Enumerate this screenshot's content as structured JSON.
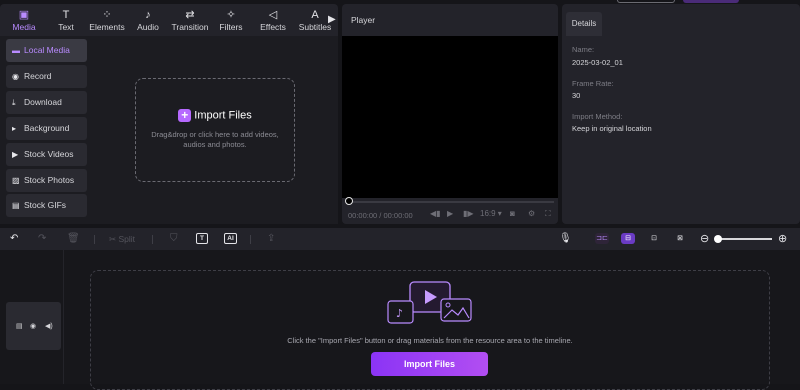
{
  "top_tabs": [
    {
      "label": "Media",
      "icon": "media-icon",
      "glyph": "▣"
    },
    {
      "label": "Text",
      "icon": "text-icon",
      "glyph": "T"
    },
    {
      "label": "Elements",
      "icon": "elements-icon",
      "glyph": "⁘"
    },
    {
      "label": "Audio",
      "icon": "audio-icon",
      "glyph": "♪"
    },
    {
      "label": "Transition",
      "icon": "transition-icon",
      "glyph": "⇄"
    },
    {
      "label": "Filters",
      "icon": "filters-icon",
      "glyph": "✧"
    },
    {
      "label": "Effects",
      "icon": "effects-icon",
      "glyph": "◁"
    },
    {
      "label": "Subtitles",
      "icon": "subtitles-icon",
      "glyph": "A"
    }
  ],
  "active_tab": "Media",
  "sidebar": {
    "items": [
      {
        "label": "Local Media",
        "icon": "folder-icon",
        "glyph": "▬"
      },
      {
        "label": "Record",
        "icon": "record-icon",
        "glyph": "◉"
      },
      {
        "label": "Download",
        "icon": "download-icon",
        "glyph": "⤓"
      },
      {
        "label": "Background",
        "icon": "background-icon",
        "glyph": "▸"
      },
      {
        "label": "Stock Videos",
        "icon": "stock-videos-icon",
        "glyph": "▶"
      },
      {
        "label": "Stock Photos",
        "icon": "stock-photos-icon",
        "glyph": "▨"
      },
      {
        "label": "Stock GIFs",
        "icon": "stock-gifs-icon",
        "glyph": "▤"
      }
    ]
  },
  "media": {
    "import_label": "Import Files",
    "drop_hint": "Drag&drop or click here to add videos, audios and photos."
  },
  "player": {
    "title": "Player",
    "timecode_current": "00:00:00",
    "timecode_separator": "/",
    "timecode_total": "00:00:00",
    "ratio": "16:9",
    "progress": 0
  },
  "details": {
    "tab_label": "Details",
    "name_label": "Name:",
    "name_value": "2025-03-02_01",
    "frame_rate_label": "Frame Rate:",
    "frame_rate_value": "30",
    "import_method_label": "Import Method:",
    "import_method_value": "Keep in original location"
  },
  "toolbar": {
    "split_label": "Split",
    "text_button": "T",
    "ai_button": "AI"
  },
  "timeline": {
    "hint": "Click the \"Import Files\" button or drag materials from the resource area to the timeline.",
    "import_button": "Import Files"
  },
  "colors": {
    "accent": "#b98bff",
    "import_gradient_start": "#8b34f5",
    "import_gradient_end": "#b24ef2"
  }
}
